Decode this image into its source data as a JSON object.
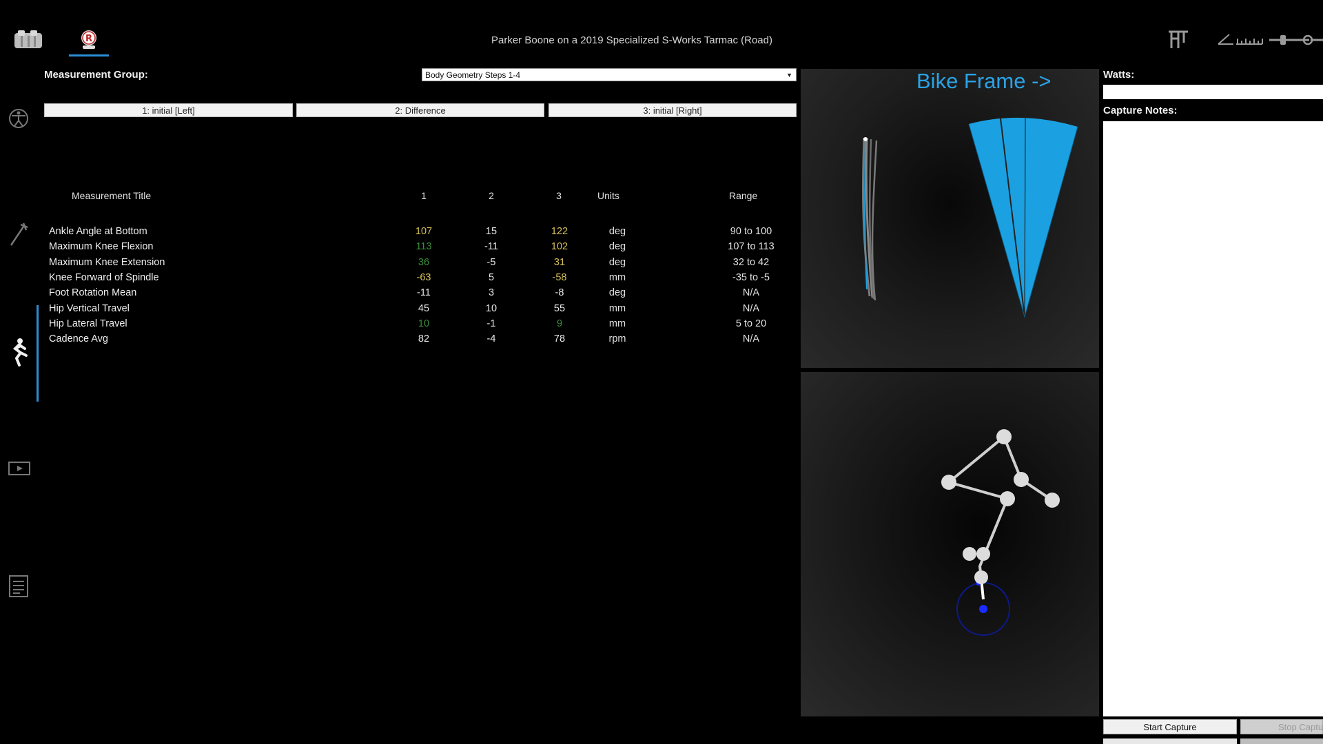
{
  "window": {
    "title": "Parker Boone on a 2019 Specialized S-Works Tarmac (Road)"
  },
  "topbar": {
    "icons": [
      "app-logo-icon",
      "rider-profile-icon",
      "bike-fit-icon",
      "angle-icon",
      "ruler-icon",
      "slider-icon"
    ]
  },
  "sidebar": {
    "icons": [
      "body-figure-icon",
      "tool-icon",
      "rider-pose-icon",
      "video-play-icon",
      "report-icon"
    ],
    "active": "rider-pose-icon"
  },
  "measurement_group": {
    "label": "Measurement Group:",
    "selected": "Body Geometry Steps 1-4"
  },
  "tabs": [
    {
      "label": "1: initial [Left]"
    },
    {
      "label": "2: Difference"
    },
    {
      "label": "3: initial [Right]"
    }
  ],
  "table": {
    "headers": {
      "title": "Measurement Title",
      "c1": "1",
      "c2": "2",
      "c3": "3",
      "units": "Units",
      "range": "Range"
    },
    "rows": [
      {
        "title": "Ankle Angle at Bottom",
        "v1": "107",
        "v2": "15",
        "v3": "122",
        "units": "deg",
        "range": "90 to 100",
        "c1": "yellow",
        "c3": "yellow"
      },
      {
        "title": "Maximum Knee Flexion",
        "v1": "113",
        "v2": "-11",
        "v3": "102",
        "units": "deg",
        "range": "107 to 113",
        "c1": "green",
        "c3": "yellow"
      },
      {
        "title": "Maximum Knee Extension",
        "v1": "36",
        "v2": "-5",
        "v3": "31",
        "units": "deg",
        "range": "32 to 42",
        "c1": "green",
        "c3": "yellow"
      },
      {
        "title": "Knee Forward of Spindle",
        "v1": "-63",
        "v2": "5",
        "v3": "-58",
        "units": "mm",
        "range": "-35 to -5",
        "c1": "yellow",
        "c3": "yellow"
      },
      {
        "title": "Foot Rotation Mean",
        "v1": "-11",
        "v2": "3",
        "v3": "-8",
        "units": "deg",
        "range": "N/A",
        "c1": "white",
        "c3": "white"
      },
      {
        "title": "Hip Vertical Travel",
        "v1": "45",
        "v2": "10",
        "v3": "55",
        "units": "mm",
        "range": "N/A",
        "c1": "white",
        "c3": "white"
      },
      {
        "title": "Hip Lateral Travel",
        "v1": "10",
        "v2": "-1",
        "v3": "9",
        "units": "mm",
        "range": "5 to 20",
        "c1": "green",
        "c3": "green"
      },
      {
        "title": "Cadence Avg",
        "v1": "82",
        "v2": "-4",
        "v3": "78",
        "units": "rpm",
        "range": "N/A",
        "c1": "white",
        "c3": "white"
      }
    ]
  },
  "viz": {
    "bike_frame_link": "Bike Frame ->",
    "accent_color": "#1ba1e2"
  },
  "capture": {
    "watts_label": "Watts:",
    "watts_value": "",
    "notes_label": "Capture Notes:",
    "notes_value": "",
    "start_label": "Start Capture",
    "stop_label": "Stop Capture"
  }
}
